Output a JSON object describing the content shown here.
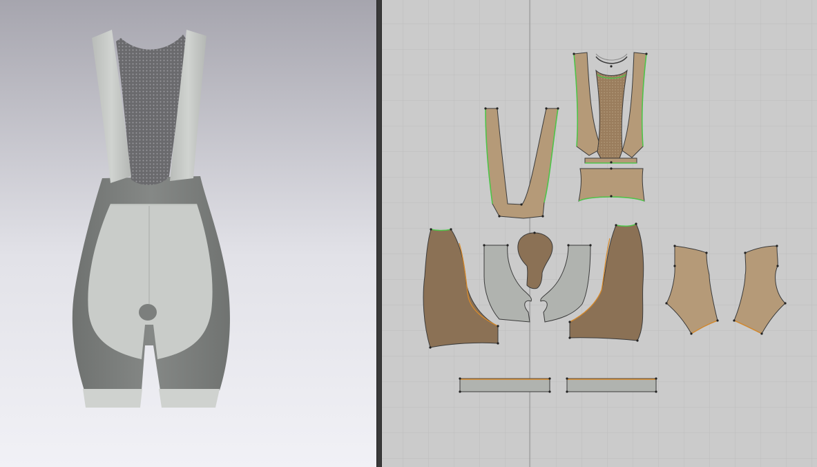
{
  "app": {
    "layout": "split-view",
    "left_panel": "3d-garment-viewport",
    "right_panel": "2d-pattern-editor"
  },
  "viewport_3d": {
    "garment": "bib-shorts",
    "background_gradient": [
      "#a6a5ae",
      "#f1f1f6"
    ],
    "colors": {
      "light_fabric": "#c6c9c6",
      "dark_fabric": "#7d807e",
      "mesh": "#6a6a6d"
    }
  },
  "viewport_2d": {
    "background": "#cbcbcb",
    "grid_color": "#bcbcbc",
    "piece_colors": {
      "tan": "#b59a78",
      "brown": "#8b7155",
      "grey": "#b0b3af",
      "mesh": "#9a7d5d",
      "selected_edge": "#4fc44a",
      "outline": "#3a3a3a"
    },
    "pieces": [
      {
        "name": "strap-front"
      },
      {
        "name": "bib-back-mesh"
      },
      {
        "name": "waist-panel"
      },
      {
        "name": "side-panel-left"
      },
      {
        "name": "chamois-seat"
      },
      {
        "name": "side-panel-right"
      },
      {
        "name": "inner-panel-left"
      },
      {
        "name": "inner-panel-right"
      },
      {
        "name": "leg-band-left"
      },
      {
        "name": "leg-band-right"
      }
    ]
  }
}
